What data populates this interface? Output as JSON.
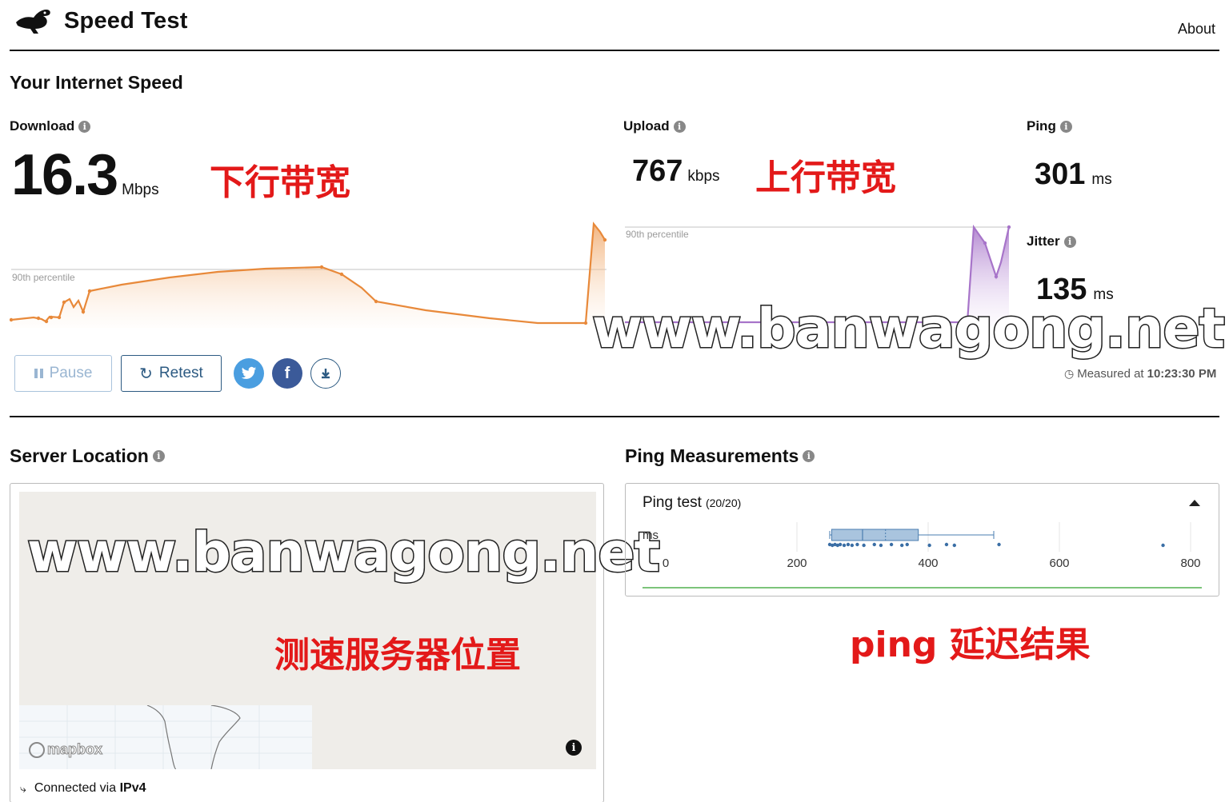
{
  "header": {
    "title": "Speed Test",
    "about_label": "About",
    "logo_icon": "rabbit-logo-icon"
  },
  "speed": {
    "section_title": "Your Internet Speed",
    "download": {
      "label": "Download",
      "value": "16.3",
      "unit": "Mbps",
      "annotation": "下行带宽",
      "percentile_label": "90th percentile"
    },
    "upload": {
      "label": "Upload",
      "value": "767",
      "unit": "kbps",
      "annotation": "上行带宽",
      "percentile_label": "90th percentile"
    },
    "ping": {
      "label": "Ping",
      "value": "301",
      "unit": "ms"
    },
    "jitter": {
      "label": "Jitter",
      "value": "135",
      "unit": "ms"
    },
    "measured_prefix": "Measured at",
    "measured_time": "10:23:30 PM"
  },
  "actions": {
    "pause_label": "Pause",
    "retest_label": "Retest",
    "twitter_icon": "twitter-icon",
    "facebook_icon": "facebook-icon",
    "download_icon": "download-icon"
  },
  "watermark": "www.banwagong.net",
  "server": {
    "title": "Server Location",
    "annotation": "测速服务器位置",
    "map_attribution": "mapbox",
    "connection_prefix": "Connected via",
    "connection_value": "IPv4"
  },
  "ping_measure": {
    "title": "Ping Measurements",
    "test_label": "Ping test",
    "test_count": "(20/20)",
    "unit_label": "ms",
    "annotation": "ping 延迟结果"
  },
  "chart_data": {
    "type": "box",
    "ticks": [
      "0",
      "200",
      "400",
      "600",
      "800"
    ],
    "xlim": [
      0,
      800
    ],
    "box": {
      "whisker_low": 250,
      "q1": 253,
      "median": 300,
      "q3": 385,
      "whisker_high": 500,
      "mean": 335
    },
    "points": [
      250,
      254,
      258,
      262,
      266,
      272,
      278,
      284,
      292,
      302,
      318,
      328,
      344,
      360,
      368,
      402,
      428,
      440,
      508,
      758
    ]
  },
  "colors": {
    "download_line": "#e8893a",
    "upload_line": "#a774c9",
    "brand_blue": "#2c5a82",
    "annotation_red": "#e31919"
  }
}
